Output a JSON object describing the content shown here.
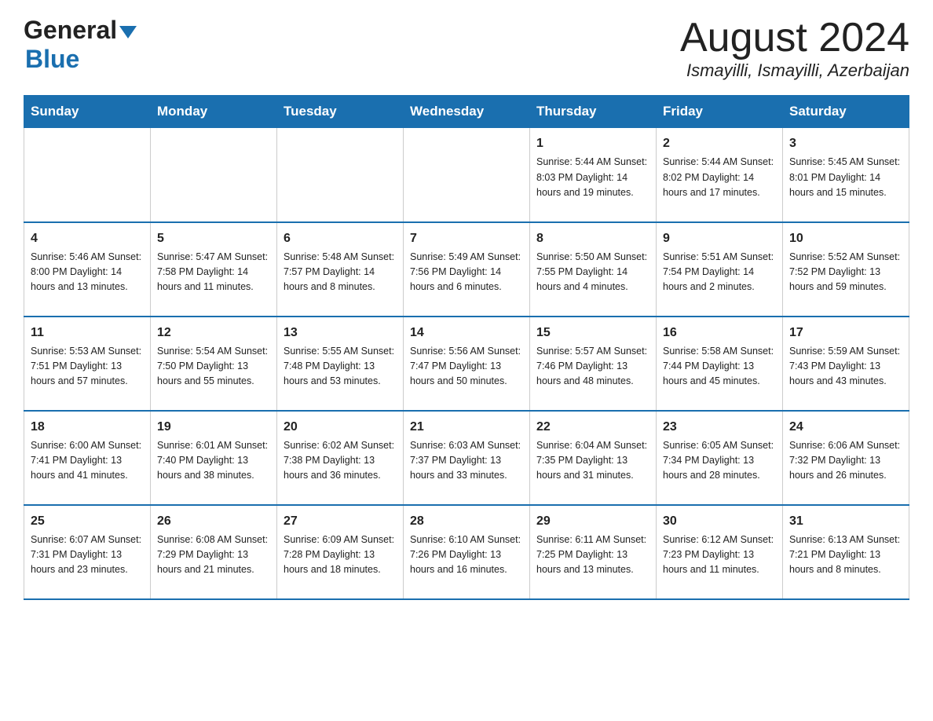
{
  "logo": {
    "text_general": "General",
    "text_blue": "Blue",
    "triangle": "▲"
  },
  "title": {
    "month_year": "August 2024",
    "location": "Ismayilli, Ismayilli, Azerbaijan"
  },
  "weekdays": [
    "Sunday",
    "Monday",
    "Tuesday",
    "Wednesday",
    "Thursday",
    "Friday",
    "Saturday"
  ],
  "weeks": [
    [
      {
        "day": "",
        "info": ""
      },
      {
        "day": "",
        "info": ""
      },
      {
        "day": "",
        "info": ""
      },
      {
        "day": "",
        "info": ""
      },
      {
        "day": "1",
        "info": "Sunrise: 5:44 AM\nSunset: 8:03 PM\nDaylight: 14 hours\nand 19 minutes."
      },
      {
        "day": "2",
        "info": "Sunrise: 5:44 AM\nSunset: 8:02 PM\nDaylight: 14 hours\nand 17 minutes."
      },
      {
        "day": "3",
        "info": "Sunrise: 5:45 AM\nSunset: 8:01 PM\nDaylight: 14 hours\nand 15 minutes."
      }
    ],
    [
      {
        "day": "4",
        "info": "Sunrise: 5:46 AM\nSunset: 8:00 PM\nDaylight: 14 hours\nand 13 minutes."
      },
      {
        "day": "5",
        "info": "Sunrise: 5:47 AM\nSunset: 7:58 PM\nDaylight: 14 hours\nand 11 minutes."
      },
      {
        "day": "6",
        "info": "Sunrise: 5:48 AM\nSunset: 7:57 PM\nDaylight: 14 hours\nand 8 minutes."
      },
      {
        "day": "7",
        "info": "Sunrise: 5:49 AM\nSunset: 7:56 PM\nDaylight: 14 hours\nand 6 minutes."
      },
      {
        "day": "8",
        "info": "Sunrise: 5:50 AM\nSunset: 7:55 PM\nDaylight: 14 hours\nand 4 minutes."
      },
      {
        "day": "9",
        "info": "Sunrise: 5:51 AM\nSunset: 7:54 PM\nDaylight: 14 hours\nand 2 minutes."
      },
      {
        "day": "10",
        "info": "Sunrise: 5:52 AM\nSunset: 7:52 PM\nDaylight: 13 hours\nand 59 minutes."
      }
    ],
    [
      {
        "day": "11",
        "info": "Sunrise: 5:53 AM\nSunset: 7:51 PM\nDaylight: 13 hours\nand 57 minutes."
      },
      {
        "day": "12",
        "info": "Sunrise: 5:54 AM\nSunset: 7:50 PM\nDaylight: 13 hours\nand 55 minutes."
      },
      {
        "day": "13",
        "info": "Sunrise: 5:55 AM\nSunset: 7:48 PM\nDaylight: 13 hours\nand 53 minutes."
      },
      {
        "day": "14",
        "info": "Sunrise: 5:56 AM\nSunset: 7:47 PM\nDaylight: 13 hours\nand 50 minutes."
      },
      {
        "day": "15",
        "info": "Sunrise: 5:57 AM\nSunset: 7:46 PM\nDaylight: 13 hours\nand 48 minutes."
      },
      {
        "day": "16",
        "info": "Sunrise: 5:58 AM\nSunset: 7:44 PM\nDaylight: 13 hours\nand 45 minutes."
      },
      {
        "day": "17",
        "info": "Sunrise: 5:59 AM\nSunset: 7:43 PM\nDaylight: 13 hours\nand 43 minutes."
      }
    ],
    [
      {
        "day": "18",
        "info": "Sunrise: 6:00 AM\nSunset: 7:41 PM\nDaylight: 13 hours\nand 41 minutes."
      },
      {
        "day": "19",
        "info": "Sunrise: 6:01 AM\nSunset: 7:40 PM\nDaylight: 13 hours\nand 38 minutes."
      },
      {
        "day": "20",
        "info": "Sunrise: 6:02 AM\nSunset: 7:38 PM\nDaylight: 13 hours\nand 36 minutes."
      },
      {
        "day": "21",
        "info": "Sunrise: 6:03 AM\nSunset: 7:37 PM\nDaylight: 13 hours\nand 33 minutes."
      },
      {
        "day": "22",
        "info": "Sunrise: 6:04 AM\nSunset: 7:35 PM\nDaylight: 13 hours\nand 31 minutes."
      },
      {
        "day": "23",
        "info": "Sunrise: 6:05 AM\nSunset: 7:34 PM\nDaylight: 13 hours\nand 28 minutes."
      },
      {
        "day": "24",
        "info": "Sunrise: 6:06 AM\nSunset: 7:32 PM\nDaylight: 13 hours\nand 26 minutes."
      }
    ],
    [
      {
        "day": "25",
        "info": "Sunrise: 6:07 AM\nSunset: 7:31 PM\nDaylight: 13 hours\nand 23 minutes."
      },
      {
        "day": "26",
        "info": "Sunrise: 6:08 AM\nSunset: 7:29 PM\nDaylight: 13 hours\nand 21 minutes."
      },
      {
        "day": "27",
        "info": "Sunrise: 6:09 AM\nSunset: 7:28 PM\nDaylight: 13 hours\nand 18 minutes."
      },
      {
        "day": "28",
        "info": "Sunrise: 6:10 AM\nSunset: 7:26 PM\nDaylight: 13 hours\nand 16 minutes."
      },
      {
        "day": "29",
        "info": "Sunrise: 6:11 AM\nSunset: 7:25 PM\nDaylight: 13 hours\nand 13 minutes."
      },
      {
        "day": "30",
        "info": "Sunrise: 6:12 AM\nSunset: 7:23 PM\nDaylight: 13 hours\nand 11 minutes."
      },
      {
        "day": "31",
        "info": "Sunrise: 6:13 AM\nSunset: 7:21 PM\nDaylight: 13 hours\nand 8 minutes."
      }
    ]
  ]
}
